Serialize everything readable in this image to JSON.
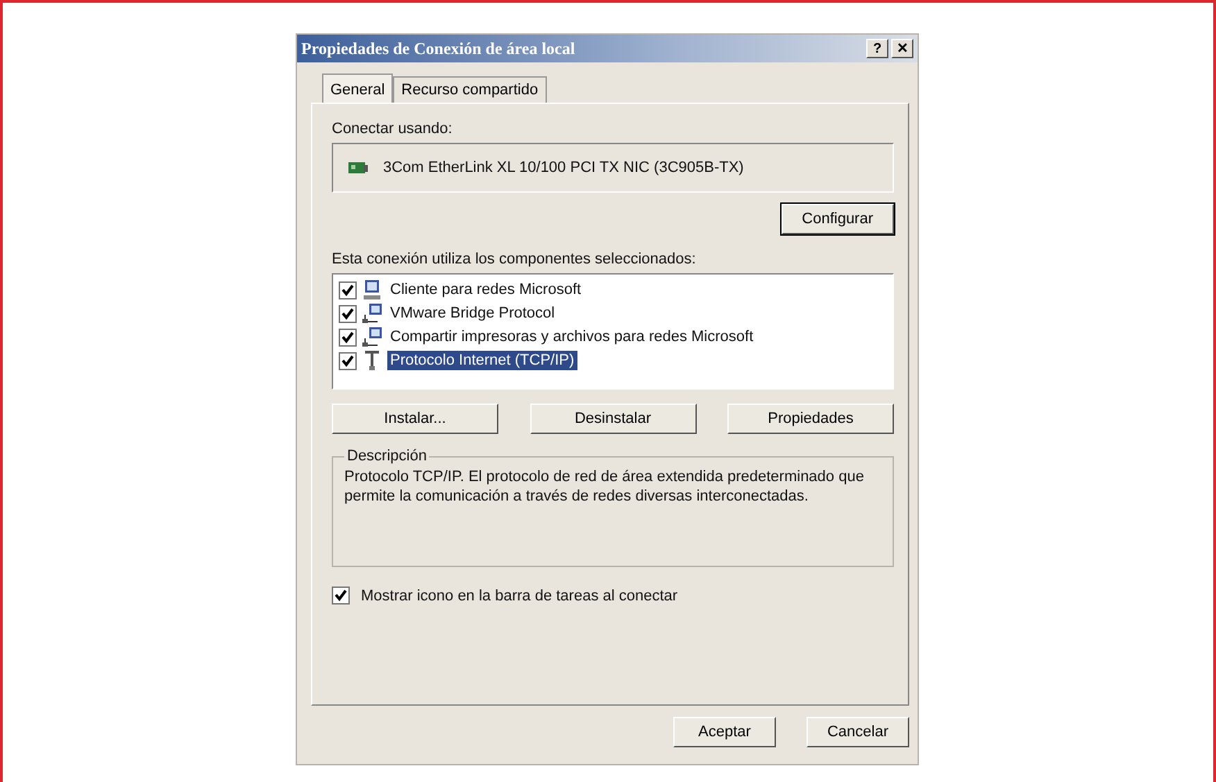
{
  "window": {
    "title": "Propiedades de Conexión de área local",
    "help": "?",
    "close": "✕"
  },
  "tabs": [
    {
      "label": "General",
      "selected": true
    },
    {
      "label": "Recurso compartido",
      "selected": false
    }
  ],
  "connect_label": "Conectar usando:",
  "adapter": "3Com EtherLink XL 10/100 PCI TX NIC (3C905B-TX)",
  "configure_button": "Configurar",
  "components_label": "Esta conexión utiliza los componentes seleccionados:",
  "components": [
    {
      "kind": "client",
      "label": "Cliente para redes Microsoft",
      "checked": true,
      "selected": false
    },
    {
      "kind": "service",
      "label": "VMware Bridge Protocol",
      "checked": true,
      "selected": false
    },
    {
      "kind": "service",
      "label": "Compartir impresoras y archivos para redes Microsoft",
      "checked": true,
      "selected": false
    },
    {
      "kind": "protocol",
      "label": "Protocolo Internet (TCP/IP)",
      "checked": true,
      "selected": true
    }
  ],
  "component_buttons": [
    "Instalar...",
    "Desinstalar",
    "Propiedades"
  ],
  "description": {
    "title": "Descripción",
    "text": "Protocolo TCP/IP. El protocolo de red de área extendida predeterminado que permite la comunicación a través de redes diversas interconectadas."
  },
  "show_icon": {
    "label": "Mostrar icono en la barra de tareas al conectar",
    "checked": true
  },
  "buttons": [
    "Aceptar",
    "Cancelar"
  ]
}
